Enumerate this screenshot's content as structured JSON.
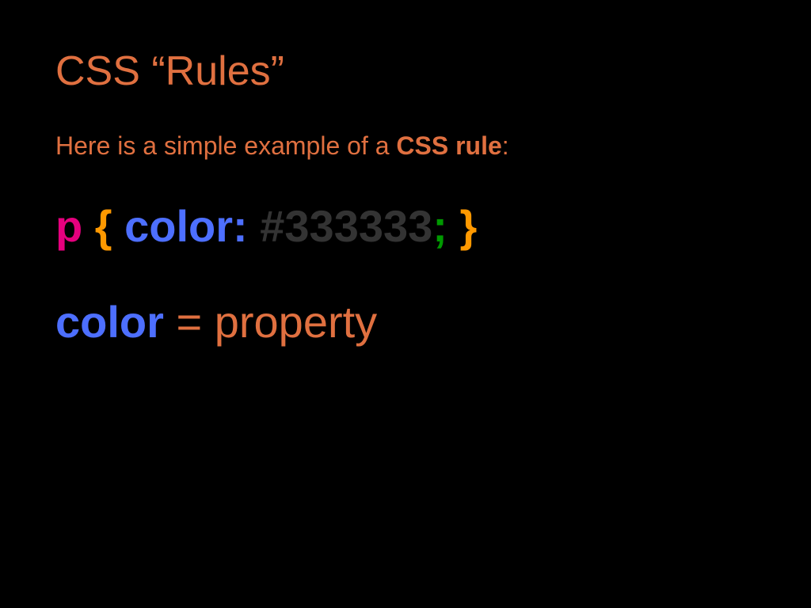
{
  "title": "CSS “Rules”",
  "intro": {
    "prefix": "Here is a simple example of a ",
    "bold": "CSS rule",
    "suffix": ":"
  },
  "code": {
    "selector": "p",
    "brace_open": "{",
    "property": "color:",
    "value": "#333333",
    "semicolon": ";",
    "brace_close": "}"
  },
  "explain": {
    "prop": "color",
    "rest": " = property"
  }
}
